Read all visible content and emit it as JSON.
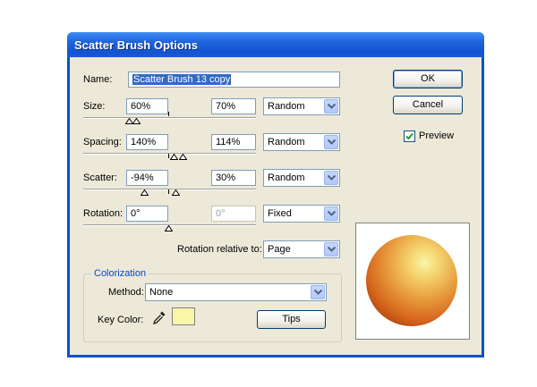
{
  "window": {
    "title": "Scatter Brush Options"
  },
  "name_field": {
    "label": "Name:",
    "value": "Scatter Brush 13 copy"
  },
  "size": {
    "label": "Size:",
    "min": "60%",
    "max": "70%",
    "variation": "Random"
  },
  "spacing": {
    "label": "Spacing:",
    "min": "140%",
    "max": "114%",
    "variation": "Random"
  },
  "scatter": {
    "label": "Scatter:",
    "min": "-94%",
    "max": "30%",
    "variation": "Random"
  },
  "rotation": {
    "label": "Rotation:",
    "min": "0°",
    "max": "0°",
    "variation": "Fixed"
  },
  "rotation_relative": {
    "label": "Rotation relative to:",
    "value": "Page"
  },
  "buttons": {
    "ok": "OK",
    "cancel": "Cancel",
    "tips": "Tips"
  },
  "preview_checkbox": {
    "label": "Preview",
    "checked": true
  },
  "colorization": {
    "group_title": "Colorization",
    "method_label": "Method:",
    "method_value": "None",
    "key_color_label": "Key Color:",
    "key_color": "#fbf5a8"
  },
  "icons": [
    "dropdown-arrow-icon",
    "eyedropper-icon",
    "checkmark-icon",
    "slider-thumb-icon"
  ],
  "colors": {
    "title_bar": "#1454d0",
    "dialog_bg": "#ece9d8",
    "field_border": "#7f9db9",
    "selection": "#316ac5",
    "group_title": "#0046d5"
  }
}
